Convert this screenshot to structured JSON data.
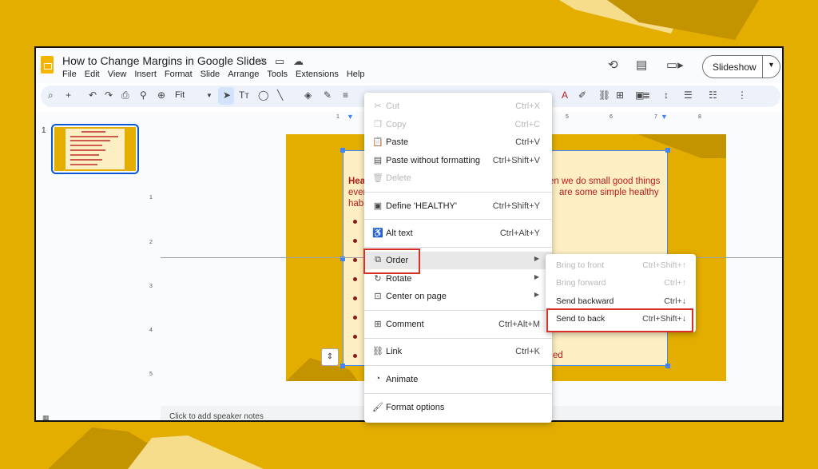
{
  "window": {
    "doc_title": "How to Change Margins in Google Slides",
    "menu": [
      "File",
      "Edit",
      "View",
      "Insert",
      "Format",
      "Slide",
      "Arrange",
      "Tools",
      "Extensions",
      "Help"
    ],
    "slideshow_label": "Slideshow"
  },
  "toolbar": {
    "zoom_label": "Fit"
  },
  "filmstrip": {
    "slide_number": "1"
  },
  "ruler": {
    "h_ticks": [
      "1",
      "5",
      "6",
      "7",
      "8"
    ],
    "v_ticks": [
      "1",
      "2",
      "3",
      "4",
      "5"
    ]
  },
  "slide": {
    "line1_a": "Heal",
    "line1_b": "en we do small good things",
    "line2_a": "ever",
    "line2_b": "are  some  simple  healthy",
    "line3_a": "habi",
    "last_fragment": "ed"
  },
  "notes": {
    "placeholder": "Click to add speaker notes"
  },
  "context_menu": {
    "items": [
      {
        "label": "Cut",
        "shortcut": "Ctrl+X",
        "icon": "scissors-icon"
      },
      {
        "label": "Copy",
        "shortcut": "Ctrl+C",
        "icon": "copy-icon"
      },
      {
        "label": "Paste",
        "shortcut": "Ctrl+V",
        "icon": "paste-icon"
      },
      {
        "label": "Paste without formatting",
        "shortcut": "Ctrl+Shift+V",
        "icon": "paste-plain-icon"
      },
      {
        "label": "Delete",
        "shortcut": "",
        "icon": "trash-icon"
      },
      {
        "label": "Define 'HEALTHY'",
        "shortcut": "Ctrl+Shift+Y",
        "icon": "dictionary-icon"
      },
      {
        "label": "Alt text",
        "shortcut": "Ctrl+Alt+Y",
        "icon": "accessibility-icon"
      },
      {
        "label": "Order",
        "shortcut": "",
        "icon": "order-icon"
      },
      {
        "label": "Rotate",
        "shortcut": "",
        "icon": "rotate-icon"
      },
      {
        "label": "Center on page",
        "shortcut": "",
        "icon": "center-icon"
      },
      {
        "label": "Comment",
        "shortcut": "Ctrl+Alt+M",
        "icon": "comment-icon"
      },
      {
        "label": "Link",
        "shortcut": "Ctrl+K",
        "icon": "link-icon"
      },
      {
        "label": "Animate",
        "shortcut": "",
        "icon": "animate-icon"
      },
      {
        "label": "Format options",
        "shortcut": "",
        "icon": "format-icon"
      }
    ]
  },
  "submenu": {
    "items": [
      {
        "label": "Bring to front",
        "shortcut": "Ctrl+Shift+↑"
      },
      {
        "label": "Bring forward",
        "shortcut": "Ctrl+↑"
      },
      {
        "label": "Send backward",
        "shortcut": "Ctrl+↓"
      },
      {
        "label": "Send to back",
        "shortcut": "Ctrl+Shift+↓"
      }
    ]
  },
  "colors": {
    "background": "#e3ae00",
    "highlight_box": "#d93025",
    "accent": "#4285f4"
  }
}
